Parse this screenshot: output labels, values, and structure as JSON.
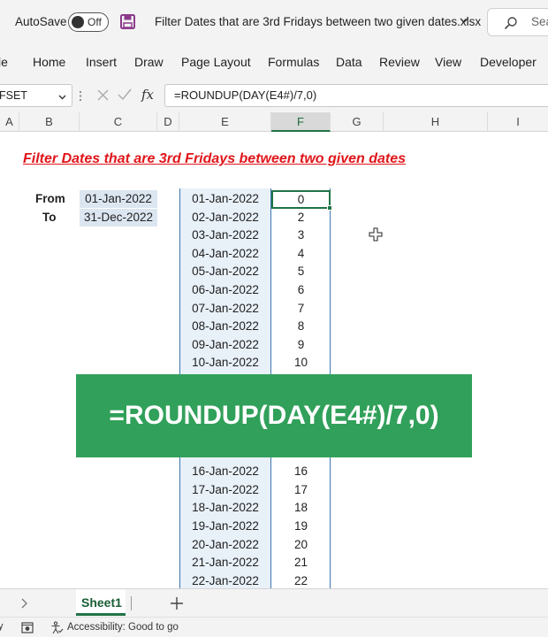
{
  "titlebar": {
    "autosave_label": "AutoSave",
    "autosave_state": "Off",
    "document_title": "Filter Dates that are 3rd Fridays between two given dates.xlsx",
    "search_placeholder": "Sea"
  },
  "ribbon": {
    "tabs": [
      "le",
      "Home",
      "Insert",
      "Draw",
      "Page Layout",
      "Formulas",
      "Data",
      "Review",
      "View",
      "Developer"
    ]
  },
  "formula_bar": {
    "name_box": "FSET",
    "fx_label": "fx",
    "formula": "=ROUNDUP(DAY(E4#)/7,0)"
  },
  "columns": [
    "A",
    "B",
    "C",
    "D",
    "E",
    "F",
    "G",
    "H",
    "I"
  ],
  "selected_column": "F",
  "sheet": {
    "title": "Filter Dates that are 3rd Fridays between two given dates",
    "from_label": "From",
    "to_label": "To",
    "from_value": "01-Jan-2022",
    "to_value": "31-Dec-2022",
    "top_rows": [
      {
        "date": "01-Jan-2022",
        "value": "0"
      },
      {
        "date": "02-Jan-2022",
        "value": "2"
      },
      {
        "date": "03-Jan-2022",
        "value": "3"
      },
      {
        "date": "04-Jan-2022",
        "value": "4"
      },
      {
        "date": "05-Jan-2022",
        "value": "5"
      },
      {
        "date": "06-Jan-2022",
        "value": "6"
      },
      {
        "date": "07-Jan-2022",
        "value": "7"
      },
      {
        "date": "08-Jan-2022",
        "value": "8"
      },
      {
        "date": "09-Jan-2022",
        "value": "9"
      },
      {
        "date": "10-Jan-2022",
        "value": "10"
      }
    ],
    "bottom_rows": [
      {
        "date": "16-Jan-2022",
        "value": "16"
      },
      {
        "date": "17-Jan-2022",
        "value": "17"
      },
      {
        "date": "18-Jan-2022",
        "value": "18"
      },
      {
        "date": "19-Jan-2022",
        "value": "19"
      },
      {
        "date": "20-Jan-2022",
        "value": "20"
      },
      {
        "date": "21-Jan-2022",
        "value": "21"
      },
      {
        "date": "22-Jan-2022",
        "value": "22"
      }
    ]
  },
  "banner": {
    "text": "=ROUNDUP(DAY(E4#)/7,0)",
    "color": "#31a05a"
  },
  "sheet_tabs": {
    "active": "Sheet1"
  },
  "status_bar": {
    "edge_text": "y",
    "accessibility": "Accessibility: Good to go"
  },
  "colors": {
    "accent": "#217346",
    "title_red": "#e0151a",
    "input_fill": "#dce6f1",
    "spill_fill": "#e8f0f8",
    "spill_border": "#3b78b0"
  },
  "icons": [
    "save-icon",
    "chevron-down-icon",
    "search-icon",
    "close-icon",
    "check-icon",
    "cell-cursor-icon",
    "chevron-right-icon",
    "plus-icon",
    "macro-record-icon",
    "accessibility-icon"
  ]
}
